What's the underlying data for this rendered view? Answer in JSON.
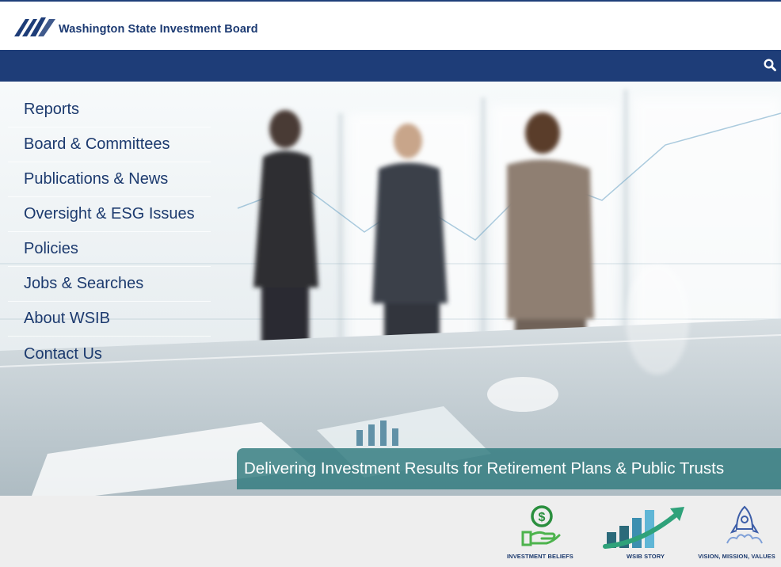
{
  "header": {
    "org_name": "Washington State Investment Board",
    "brand_color": "#1e3d78",
    "logo_icon": "wsib-mountains-logo"
  },
  "navbar": {
    "search_icon": "search-icon"
  },
  "menu": {
    "items": [
      {
        "label": "Reports"
      },
      {
        "label": "Board & Committees"
      },
      {
        "label": "Publications & News"
      },
      {
        "label": "Oversight & ESG Issues"
      },
      {
        "label": "Policies"
      },
      {
        "label": "Jobs & Searches"
      },
      {
        "label": "About WSIB"
      },
      {
        "label": "Contact Us"
      }
    ]
  },
  "hero": {
    "tagline": "Delivering Investment Results for Retirement Plans & Public Trusts",
    "tagline_color": "#2f7a7e"
  },
  "features": [
    {
      "label": "INVESTMENT BELIEFS",
      "icon": "money-hand-icon"
    },
    {
      "label": "WSIB STORY",
      "icon": "growth-chart-icon"
    },
    {
      "label": "VISION, MISSION, VALUES",
      "icon": "rocket-icon"
    }
  ]
}
